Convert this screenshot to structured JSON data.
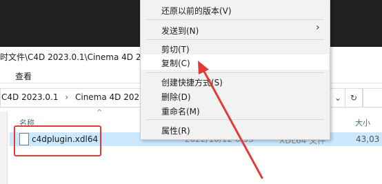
{
  "window": {
    "title_partial": "时文件\\C4D 2023.0.1\\Cinema 4D 2023",
    "ribbon_view": "查看"
  },
  "address_bar": {
    "seg1": "C4D 2023.0.1",
    "sep": "›",
    "seg2": "Cinema 4D 2023.0.1",
    "dropdown_icon": "chevron-down-icon",
    "refresh_icon": "refresh-icon"
  },
  "file_list": {
    "columns": {
      "name": "名称",
      "size": "大小"
    },
    "sort_indicator": "^",
    "rows": [
      {
        "name": "c4dplugin.xdl64",
        "date": "2022/10/12 6:53",
        "type": "XDL64 文件",
        "size": "43,03"
      }
    ]
  },
  "context_menu": {
    "items": [
      {
        "label": "还原以前的版本(V)"
      },
      {
        "label": "发送到(N)",
        "submenu": true
      },
      {
        "label": "剪切(T)"
      },
      {
        "label": "复制(C)",
        "highlighted": true
      },
      {
        "label": "创建快捷方式(S)"
      },
      {
        "label": "删除(D)"
      },
      {
        "label": "重命名(M)"
      },
      {
        "label": "属性(R)"
      }
    ],
    "submenu_glyph": "›"
  },
  "annotation": {
    "color": "#e53935"
  }
}
